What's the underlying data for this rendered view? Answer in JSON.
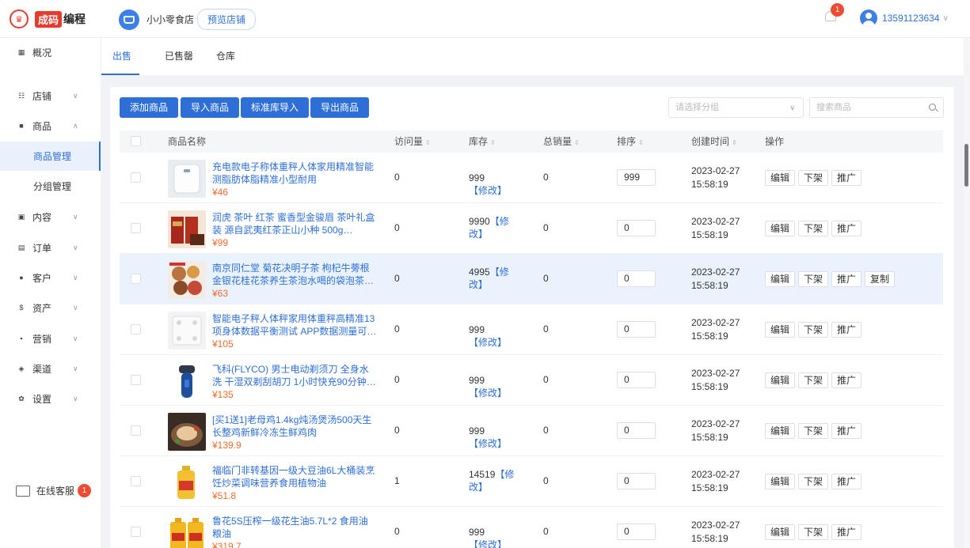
{
  "header": {
    "logo_tag": "成码",
    "logo_text": "编程",
    "shop_name": "小小零食店",
    "preview_label": "预览店铺",
    "notification_count": "1",
    "user_phone": "13591123634"
  },
  "sidebar": {
    "items": [
      {
        "icon": "grid-icon",
        "glyph": "▦",
        "label": "概况",
        "caret": ""
      },
      {
        "icon": "store-icon",
        "glyph": "☷",
        "label": "店铺",
        "caret": "∨"
      },
      {
        "icon": "goods-icon",
        "glyph": "■",
        "label": "商品",
        "caret": "∧"
      },
      {
        "icon": "content-icon",
        "glyph": "▣",
        "label": "内容",
        "caret": "∨"
      },
      {
        "icon": "order-icon",
        "glyph": "▤",
        "label": "订单",
        "caret": "∨"
      },
      {
        "icon": "customer-icon",
        "glyph": "●",
        "label": "客户",
        "caret": "∨"
      },
      {
        "icon": "asset-icon",
        "glyph": "$",
        "label": "资产",
        "caret": "∨"
      },
      {
        "icon": "marketing-icon",
        "glyph": "▪",
        "label": "营销",
        "caret": "∨"
      },
      {
        "icon": "channel-icon",
        "glyph": "◈",
        "label": "渠道",
        "caret": "∨"
      },
      {
        "icon": "settings-icon",
        "glyph": "✿",
        "label": "设置",
        "caret": "∨"
      }
    ],
    "sub_items": [
      "商品管理",
      "分组管理"
    ],
    "support_label": "在线客服",
    "support_count": "1"
  },
  "tabs": [
    "出售中",
    "已售罄",
    "仓库"
  ],
  "toolbar": {
    "buttons": [
      "添加商品",
      "导入商品",
      "标准库导入",
      "导出商品"
    ],
    "group_placeholder": "请选择分组",
    "search_placeholder": "搜索商品"
  },
  "table": {
    "headers": {
      "name": "商品名称",
      "visits": "访问量",
      "stock": "库存",
      "sales": "总销量",
      "sort": "排序",
      "created": "创建时间",
      "ops": "操作"
    },
    "sort_glyph": "⇕",
    "modify_label": "【修改】",
    "op_labels": {
      "edit": "编辑",
      "off": "下架",
      "promote": "推广",
      "copy": "复制"
    },
    "rows": [
      {
        "name": "充电款电子称体重秤人体家用精准智能测脂肪体脂精准小型耐用",
        "price": "¥46",
        "visits": "0",
        "stock": "999",
        "sales": "0",
        "sort": "999",
        "date": "2023-02-27",
        "time": "15:58:19",
        "thumb": "scale"
      },
      {
        "name": "润虎 茶叶 红茶 蜜香型金骏眉 茶叶礼盒装 源自武夷红茶正山小种 500g（250g*2...",
        "price": "¥99",
        "visits": "0",
        "stock": "9990",
        "sales": "0",
        "sort": "0",
        "date": "2023-02-27",
        "time": "15:58:19",
        "thumb": "tea"
      },
      {
        "name": "南京同仁堂 菊花决明子茶 枸杞牛蒡根金银花桂花茶养生茶泡水喝的袋泡茶（新...",
        "price": "¥63",
        "visits": "0",
        "stock": "4995",
        "sales": "0",
        "sort": "0",
        "date": "2023-02-27",
        "time": "15:58:19",
        "thumb": "herbal"
      },
      {
        "name": "智能电子秤人体秤家用体重秤高精准13项身体数据平衡测试 APP数据测量可称...",
        "price": "¥105",
        "visits": "0",
        "stock": "999",
        "sales": "0",
        "sort": "0",
        "date": "2023-02-27",
        "time": "15:58:19",
        "thumb": "smartscale"
      },
      {
        "name": "飞科(FLYCO) 男士电动剃须刀 全身水洗 干湿双剃刮胡刀 1小时快充90分钟长续...",
        "price": "¥135",
        "visits": "0",
        "stock": "999",
        "sales": "0",
        "sort": "0",
        "date": "2023-02-27",
        "time": "15:58:19",
        "thumb": "shaver"
      },
      {
        "name": "[买1送1]老母鸡1.4kg炖汤煲汤500天生长整鸡新鲜冷冻生鲜鸡肉",
        "price": "¥139.9",
        "visits": "0",
        "stock": "999",
        "sales": "0",
        "sort": "0",
        "date": "2023-02-27",
        "time": "15:58:19",
        "thumb": "chicken"
      },
      {
        "name": "福临门非转基因一级大豆油6L大桶装烹饪炒菜调味营养食用植物油",
        "price": "¥51.8",
        "visits": "1",
        "stock": "14519",
        "sales": "0",
        "sort": "0",
        "date": "2023-02-27",
        "time": "15:58:19",
        "thumb": "oil"
      },
      {
        "name": "鲁花5S压榨一级花生油5.7L*2 食用油 粮油",
        "price": "¥319.7",
        "visits": "0",
        "stock": "999",
        "sales": "0",
        "sort": "0",
        "date": "2023-02-27",
        "time": "15:58:19",
        "thumb": "peanutoil"
      }
    ]
  },
  "colors": {
    "accent": "#2d6fd6",
    "price": "#f06a2b",
    "badge": "#f04b32",
    "highlight_row": "#eaf3fd"
  }
}
